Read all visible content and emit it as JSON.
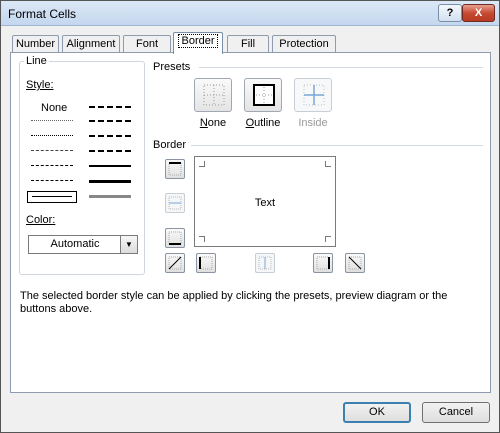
{
  "window": {
    "title": "Format Cells",
    "help": "?",
    "close": "X"
  },
  "tabs": [
    {
      "label": "Number"
    },
    {
      "label": "Alignment"
    },
    {
      "label": "Font"
    },
    {
      "label": "Border"
    },
    {
      "label": "Fill"
    },
    {
      "label": "Protection"
    }
  ],
  "active_tab": "Border",
  "line": {
    "title": "Line",
    "style_label": "Style:",
    "style_none": "None",
    "color_label": "Color:",
    "color_value": "Automatic"
  },
  "presets": {
    "title": "Presets",
    "none": "None",
    "outline": "Outline",
    "inside": "Inside"
  },
  "border": {
    "title": "Border",
    "preview_text": "Text"
  },
  "note": "The selected border style can be applied by clicking the presets, preview diagram or the buttons above.",
  "buttons": {
    "ok": "OK",
    "cancel": "Cancel"
  }
}
